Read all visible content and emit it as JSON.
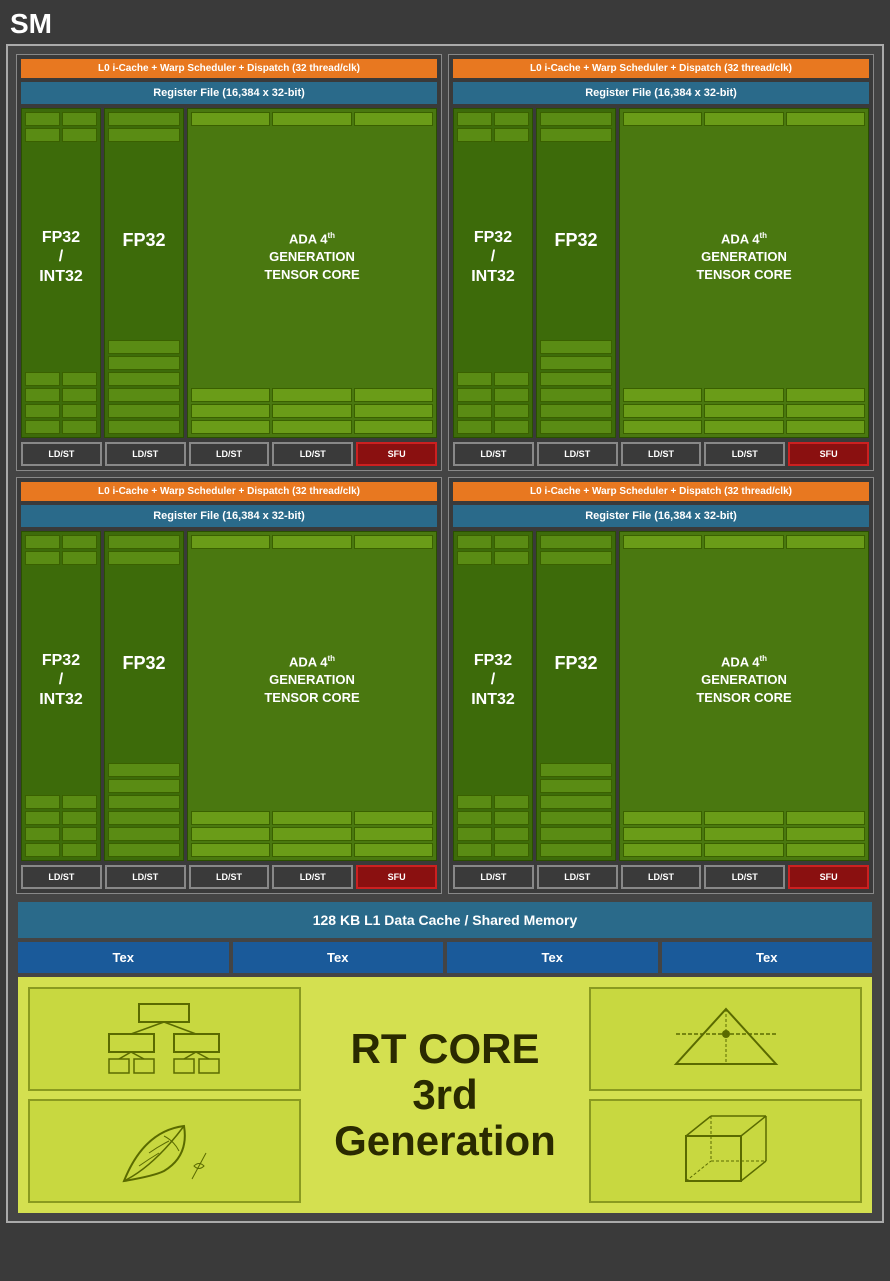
{
  "title": "SM",
  "quadrants": [
    {
      "id": "q1",
      "warp_label": "L0 i-Cache + Warp Scheduler + Dispatch (32 thread/clk)",
      "regfile_label": "Register File (16,384 x 32-bit)",
      "fp32int32_label": "FP32\n/\nINT32",
      "fp32_label": "FP32",
      "tensor_label": "ADA 4th GENERATION TENSOR CORE",
      "ldst_labels": [
        "LD/ST",
        "LD/ST",
        "LD/ST",
        "LD/ST"
      ],
      "sfu_label": "SFU"
    },
    {
      "id": "q2",
      "warp_label": "L0 i-Cache + Warp Scheduler + Dispatch (32 thread/clk)",
      "regfile_label": "Register File (16,384 x 32-bit)",
      "fp32int32_label": "FP32\n/\nINT32",
      "fp32_label": "FP32",
      "tensor_label": "ADA 4th GENERATION TENSOR CORE",
      "ldst_labels": [
        "LD/ST",
        "LD/ST",
        "LD/ST",
        "LD/ST"
      ],
      "sfu_label": "SFU"
    },
    {
      "id": "q3",
      "warp_label": "L0 i-Cache + Warp Scheduler + Dispatch (32 thread/clk)",
      "regfile_label": "Register File (16,384 x 32-bit)",
      "fp32int32_label": "FP32\n/\nINT32",
      "fp32_label": "FP32",
      "tensor_label": "ADA 4th GENERATION TENSOR CORE",
      "ldst_labels": [
        "LD/ST",
        "LD/ST",
        "LD/ST",
        "LD/ST"
      ],
      "sfu_label": "SFU"
    },
    {
      "id": "q4",
      "warp_label": "L0 i-Cache + Warp Scheduler + Dispatch (32 thread/clk)",
      "regfile_label": "Register File (16,384 x 32-bit)",
      "fp32int32_label": "FP32\n/\nINT32",
      "fp32_label": "FP32",
      "tensor_label": "ADA 4th GENERATION TENSOR CORE",
      "ldst_labels": [
        "LD/ST",
        "LD/ST",
        "LD/ST",
        "LD/ST"
      ],
      "sfu_label": "SFU"
    }
  ],
  "l1_cache_label": "128 KB L1 Data Cache / Shared Memory",
  "tex_labels": [
    "Tex",
    "Tex",
    "Tex",
    "Tex"
  ],
  "rt_core": {
    "line1": "RT CORE",
    "line2": "3rd Generation"
  }
}
